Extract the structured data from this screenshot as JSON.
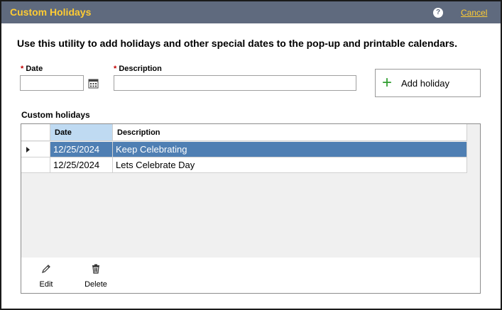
{
  "dialog": {
    "title": "Custom Holidays",
    "help_label": "?",
    "cancel_label": "Cancel",
    "instructions": "Use this utility to add holidays and other special dates to the pop-up and printable calendars."
  },
  "form": {
    "required_mark": "*",
    "date_label": "Date",
    "date_value": "",
    "description_label": "Description",
    "description_value": "",
    "add_button_label": "Add holiday",
    "add_icon": "plus-icon",
    "calendar_icon": "calendar-icon"
  },
  "holidays": {
    "section_label": "Custom holidays",
    "columns": [
      "Date",
      "Description"
    ],
    "rows": [
      {
        "date": "12/25/2024",
        "description": "Keep Celebrating",
        "selected": true
      },
      {
        "date": "12/25/2024",
        "description": "Lets Celebrate Day",
        "selected": false
      }
    ]
  },
  "toolbar": {
    "edit_label": "Edit",
    "delete_label": "Delete",
    "edit_icon": "pencil-icon",
    "delete_icon": "trash-icon"
  },
  "colors": {
    "titlebar": "#5f6a7e",
    "title_text": "#ffcc33",
    "selected_row": "#4f7fb3",
    "header_date_cell": "#bfdaf2",
    "plus_green": "#2e9d2e",
    "required_red": "#c00000"
  }
}
